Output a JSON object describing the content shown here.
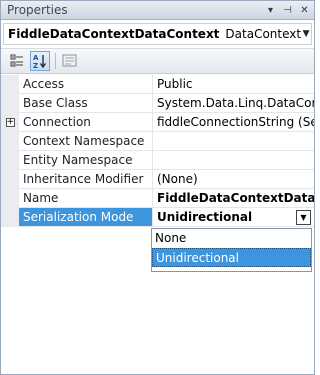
{
  "window": {
    "title": "Properties",
    "pin_glyph": "▾",
    "autohide_glyph": "⊣",
    "close_glyph": "✕"
  },
  "object_selector": {
    "name": "FiddleDataContextDataContext",
    "type": "DataContext"
  },
  "toolbar": {
    "buttons": [
      "categorized",
      "alphabetical",
      "property-pages"
    ]
  },
  "properties": [
    {
      "name": "Access",
      "value": "Public"
    },
    {
      "name": "Base Class",
      "value": "System.Data.Linq.DataContex"
    },
    {
      "name": "Connection",
      "value": "fiddleConnectionString (Setti",
      "expandable": true
    },
    {
      "name": "Context Namespace",
      "value": ""
    },
    {
      "name": "Entity Namespace",
      "value": ""
    },
    {
      "name": "Inheritance Modifier",
      "value": "(None)"
    },
    {
      "name": "Name",
      "value": "FiddleDataContextDataCont"
    },
    {
      "name": "Serialization Mode",
      "value": "Unidirectional"
    }
  ],
  "dropdown": {
    "options": [
      "None",
      "Unidirectional"
    ],
    "selected": "Unidirectional"
  },
  "colors": {
    "selection": "#3d95dd",
    "titlebar_text": "#3b4a5c"
  }
}
